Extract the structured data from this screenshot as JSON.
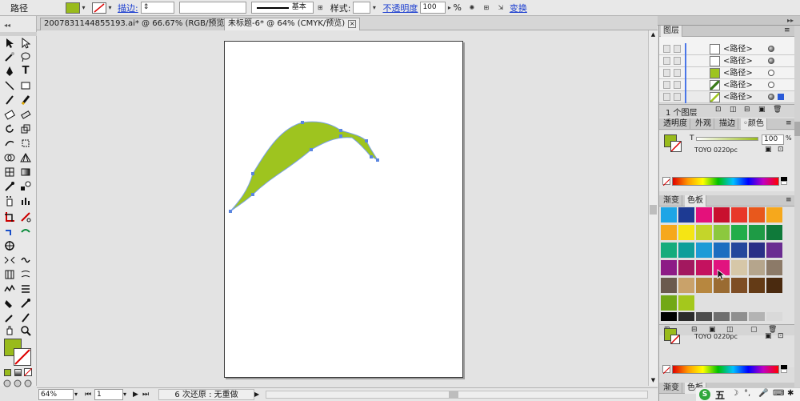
{
  "control_bar": {
    "object_label": "路径",
    "stroke_label": "描边:",
    "stroke_profile": "基本",
    "style_label": "样式:",
    "opacity_label": "不透明度",
    "opacity_value": "100",
    "opacity_unit": "%",
    "transform_label": "变换",
    "fill_color": "#99bb1c"
  },
  "doc_tabs": [
    {
      "label": "2007831144855193.ai* @ 66.67% (RGB/预览)",
      "active": false
    },
    {
      "label": "未标题-6* @ 64% (CMYK/预览)",
      "active": true
    }
  ],
  "status_bar": {
    "zoom": "64%",
    "page": "1",
    "undo_text": "6 次还原 : 无重做"
  },
  "layers_panel": {
    "title": "图层",
    "rows": [
      "<路径>",
      "<路径>",
      "<路径>",
      "<路径>",
      "<路径>"
    ],
    "footer": "1 个图层"
  },
  "color_panel": {
    "tabs": [
      "透明度",
      "外观",
      "描边",
      "颜色"
    ],
    "tint_label": "T",
    "tint_value": "100",
    "tint_unit": "%",
    "swatch_name": "TOYO 0220pc"
  },
  "swatches_panel": {
    "tabs": [
      "渐变",
      "色板"
    ],
    "swatch_name": "TOYO 0220pc",
    "rows": [
      [
        "#1ea5e6",
        "#1d3a93",
        "#e4117b",
        "#c8102e",
        "#e8382a",
        "#e8581c",
        "#f6a81c"
      ],
      [
        "#f6a81c",
        "#f5e514",
        "#c4d52a",
        "#8cc83e",
        "#22ad4a",
        "#1e9b45",
        "#0f7a3a"
      ],
      [
        "#16ac7c",
        "#0e9e9a",
        "#1c9bd7",
        "#1b6ec0",
        "#24479c",
        "#2a2f87",
        "#6a2c91"
      ],
      [
        "#8d1b86",
        "#a3185f",
        "#c4125f",
        "#e1137f",
        "#d6c7a8",
        "#b5a58c",
        "#8c7a68"
      ],
      [
        "#6b5a4e",
        "#c9a26a",
        "#b7873f",
        "#9a6b32",
        "#7e4e25",
        "#643b16",
        "#4a2a0f"
      ],
      [
        "#72a816",
        "#a4c81c"
      ]
    ],
    "grays": [
      "#000000",
      "#2b2b2b",
      "#4d4d4d",
      "#6e6e6e",
      "#8f8f8f",
      "#b3b3b3",
      "#d9d9d9"
    ]
  },
  "bottom_tabs": [
    "渐变",
    "色板"
  ],
  "ime": {
    "label": "五"
  }
}
